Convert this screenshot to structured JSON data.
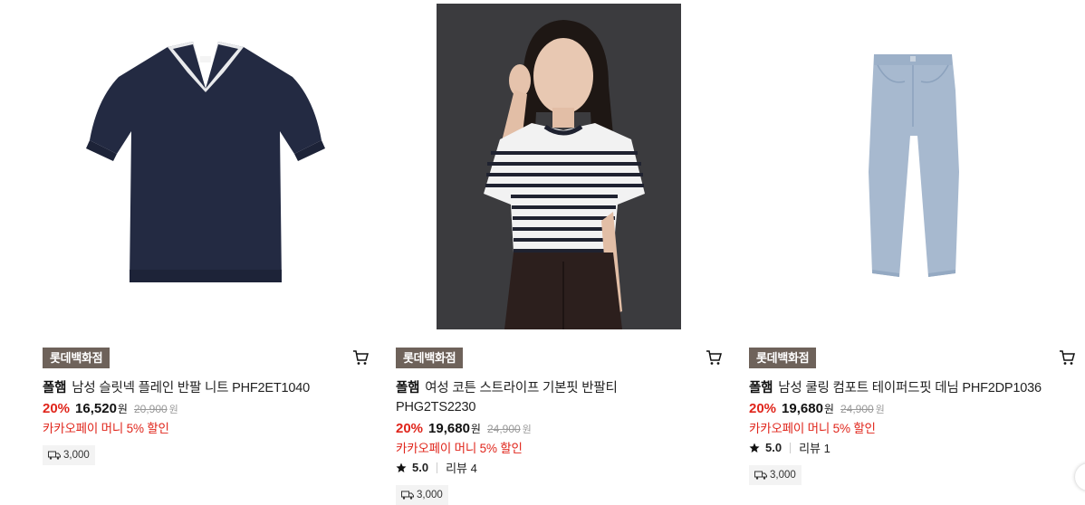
{
  "products": [
    {
      "store_badge": "롯데백화점",
      "brand": "폴햄",
      "name": "남성 슬릿넥 플레인 반팔 니트 PHF2ET1040",
      "discount": "20%",
      "price": "16,520",
      "currency": "원",
      "original_price": "20,900",
      "original_currency": "원",
      "promo": "카카오페이 머니 5% 할인",
      "delivery_fee": "3,000"
    },
    {
      "store_badge": "롯데백화점",
      "brand": "폴햄",
      "name": "여성 코튼 스트라이프 기본핏 반팔티 PHG2TS2230",
      "discount": "20%",
      "price": "19,680",
      "currency": "원",
      "original_price": "24,900",
      "original_currency": "원",
      "promo": "카카오페이 머니 5% 할인",
      "rating": "5.0",
      "reviews": "리뷰 4",
      "delivery_fee": "3,000"
    },
    {
      "store_badge": "롯데백화점",
      "brand": "폴햄",
      "name": "남성 쿨링 컴포트 테이퍼드핏 데님 PHF2DP1036",
      "discount": "20%",
      "price": "19,680",
      "currency": "원",
      "original_price": "24,900",
      "original_currency": "원",
      "promo": "카카오페이 머니 5% 할인",
      "rating": "5.0",
      "reviews": "리뷰 1",
      "delivery_fee": "3,000"
    }
  ],
  "icons": {
    "cart": "cart-icon",
    "star": "star-icon",
    "truck": "truck-icon"
  },
  "colors": {
    "badge_bg": "#6e625a",
    "discount": "#e0251b",
    "promo": "#e0251b"
  }
}
